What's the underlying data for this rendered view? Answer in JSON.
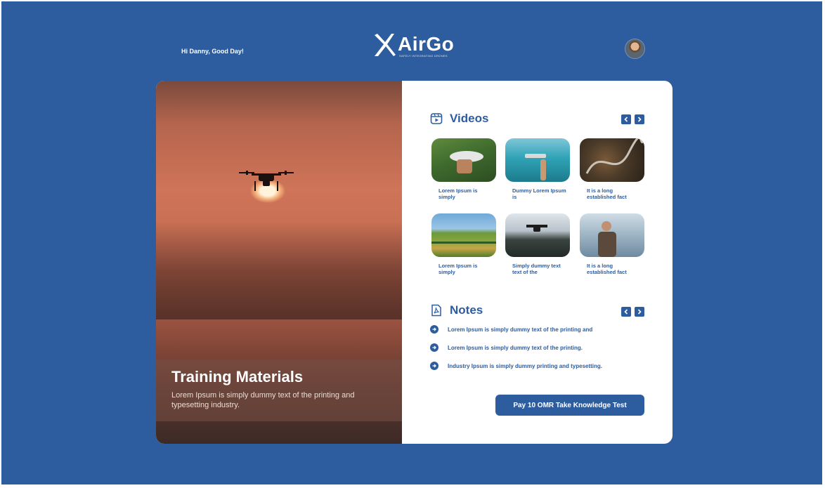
{
  "header": {
    "greeting": "Hi Danny, Good Day!",
    "brand": "AirGo",
    "tagline": "SAFELY INTEGRATING DRONES"
  },
  "hero": {
    "title": "Training Materials",
    "subtitle": "Lorem Ipsum is simply dummy text of the printing and typesetting industry."
  },
  "videos": {
    "title": "Videos",
    "items": [
      {
        "caption": "Lorem Ipsum is simply"
      },
      {
        "caption": "Dummy Lorem Ipsum is"
      },
      {
        "caption": "It is a long established fact"
      },
      {
        "caption": "Lorem Ipsum is simply"
      },
      {
        "caption": "Simply dummy text text of the"
      },
      {
        "caption": "It is a long established fact"
      }
    ]
  },
  "notes": {
    "title": "Notes",
    "items": [
      {
        "text": "Lorem Ipsum is simply dummy text of the printing and"
      },
      {
        "text": "Lorem Ipsum is simply dummy text of the printing."
      },
      {
        "text": "Industry Ipsum is simply dummy printing and typesetting."
      }
    ]
  },
  "cta": {
    "label": "Pay 10 OMR Take Knowledge Test"
  },
  "colors": {
    "brand": "#2d5d9f",
    "background": "#2d5d9f",
    "card": "#ffffff"
  },
  "icons": [
    "video-icon",
    "pdf-icon",
    "chevron-left-icon",
    "chevron-right-icon",
    "arrow-right-circle-icon"
  ]
}
